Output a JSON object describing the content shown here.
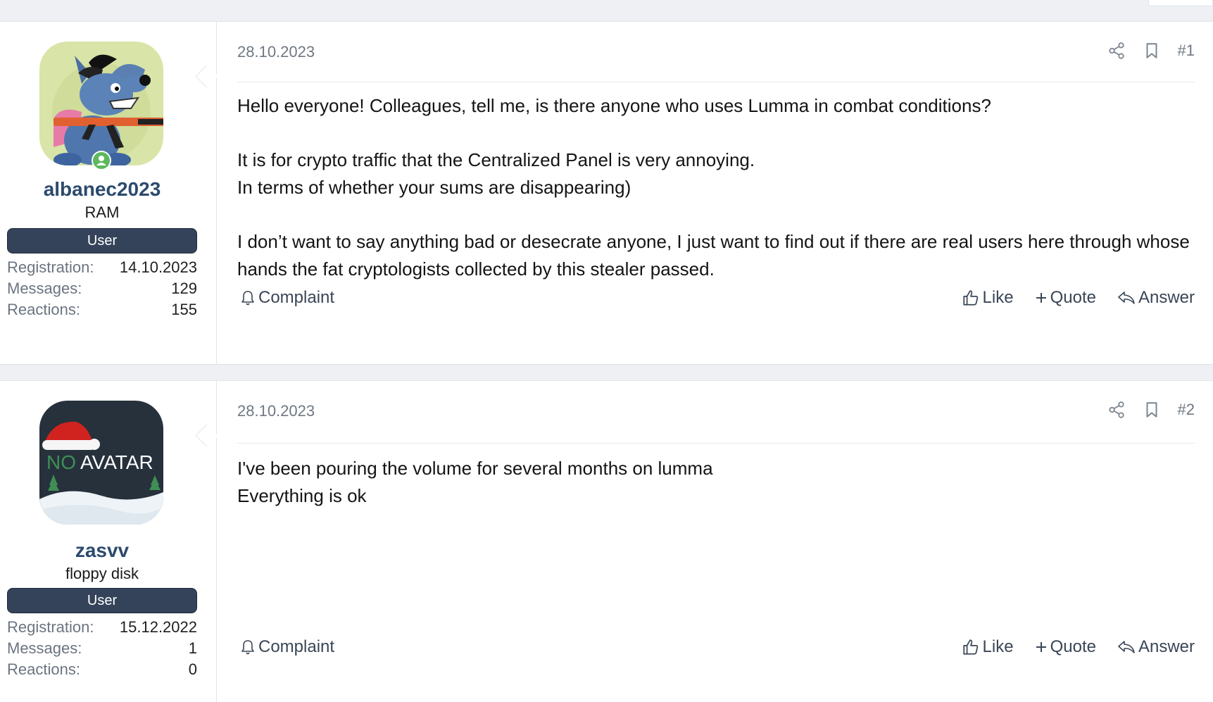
{
  "posts": [
    {
      "date": "28.10.2023",
      "number": "#1",
      "author": {
        "username": "albanec2023",
        "title": "RAM",
        "role_badge": "User",
        "avatar_icon": "wolf-with-rifle-avatar",
        "online": true,
        "stats": [
          {
            "label": "Registration:",
            "value": "14.10.2023"
          },
          {
            "label": "Messages:",
            "value": "129"
          },
          {
            "label": "Reactions:",
            "value": "155"
          }
        ]
      },
      "body": [
        "Hello everyone! Colleagues, tell me, is there anyone who uses Lumma in combat conditions?",
        "",
        "It is for crypto traffic that the Centralized Panel is very annoying.",
        "In terms of whether your sums are disappearing)",
        "",
        "I don’t want to say anything bad or desecrate anyone, I just want to find out if there are real users here through whose hands the fat cryptologists collected by this stealer passed."
      ],
      "actions": {
        "complaint": "Complaint",
        "like": "Like",
        "quote": "Quote",
        "answer": "Answer"
      }
    },
    {
      "date": "28.10.2023",
      "number": "#2",
      "author": {
        "username": "zasvv",
        "title": "floppy disk",
        "role_badge": "User",
        "avatar_icon": "no-avatar-placeholder",
        "avatar_text": {
          "no": "NO",
          "avatar": "AVATAR"
        },
        "stats": [
          {
            "label": "Registration:",
            "value": "15.12.2022"
          },
          {
            "label": "Messages:",
            "value": "1"
          },
          {
            "label": "Reactions:",
            "value": "0"
          }
        ]
      },
      "body": [
        "I've been pouring the volume for several months on lumma",
        "Everything is ok"
      ],
      "actions": {
        "complaint": "Complaint",
        "like": "Like",
        "quote": "Quote",
        "answer": "Answer"
      }
    }
  ],
  "icons": [
    "share-icon",
    "bookmark-icon",
    "bell-icon",
    "thumbs-up-icon",
    "plus-icon",
    "reply-icon",
    "online-user-icon"
  ],
  "colors": {
    "badge_bg": "#34435a",
    "username": "#2c4a6e",
    "online_green": "#5cb85c",
    "muted": "#6f7882"
  }
}
